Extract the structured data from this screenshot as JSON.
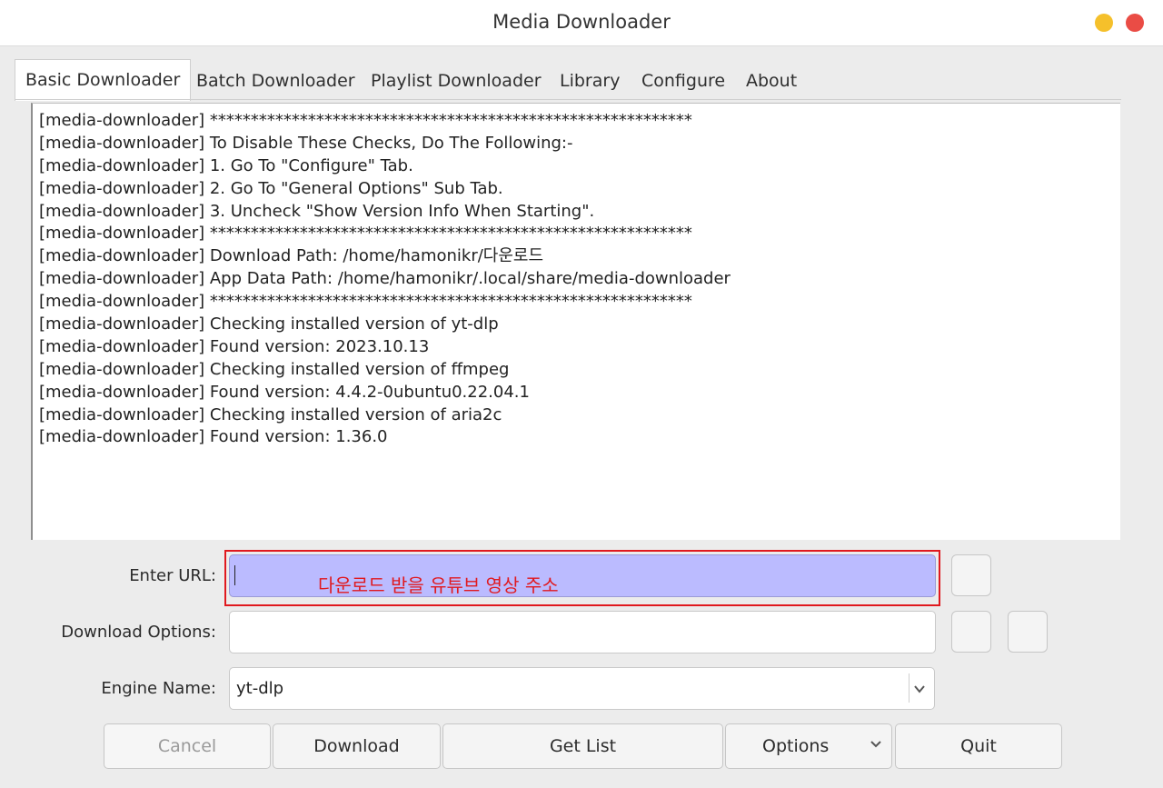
{
  "window": {
    "title": "Media Downloader"
  },
  "tabs": [
    {
      "label": "Basic Downloader"
    },
    {
      "label": "Batch Downloader"
    },
    {
      "label": "Playlist Downloader"
    },
    {
      "label": "Library"
    },
    {
      "label": "Configure"
    },
    {
      "label": "About"
    }
  ],
  "log": {
    "lines": [
      "[media-downloader] ***********************************************************",
      "[media-downloader] To Disable These Checks, Do The Following:-",
      "[media-downloader] 1. Go To \"Configure\" Tab.",
      "[media-downloader] 2. Go To \"General Options\" Sub Tab.",
      "[media-downloader] 3. Uncheck \"Show Version Info When Starting\".",
      "[media-downloader] ***********************************************************",
      "[media-downloader] Download Path: /home/hamonikr/다운로드",
      "[media-downloader] App Data Path: /home/hamonikr/.local/share/media-downloader",
      "[media-downloader] ***********************************************************",
      "[media-downloader] Checking installed version of yt-dlp",
      "[media-downloader] Found version: 2023.10.13",
      "[media-downloader] Checking installed version of ffmpeg",
      "[media-downloader] Found version: 4.4.2-0ubuntu0.22.04.1",
      "[media-downloader] Checking installed version of aria2c",
      "[media-downloader] Found version: 1.36.0"
    ]
  },
  "form": {
    "url_label": "Enter URL:",
    "url_value": "",
    "url_annotation": "다운로드 받을 유튜브 영상 주소",
    "options_label": "Download Options:",
    "options_value": "",
    "engine_label": "Engine Name:",
    "engine_value": "yt-dlp"
  },
  "buttons": {
    "cancel": "Cancel",
    "download": "Download",
    "get_list": "Get List",
    "options": "Options",
    "quit": "Quit"
  },
  "colors": {
    "url_field_bg": "#bbbbff",
    "annotation": "#e0191f",
    "minimize": "#f5c02b",
    "close": "#ea4c45"
  },
  "icons": [
    "chevron-down-icon",
    "dropdown-arrow-icon"
  ]
}
